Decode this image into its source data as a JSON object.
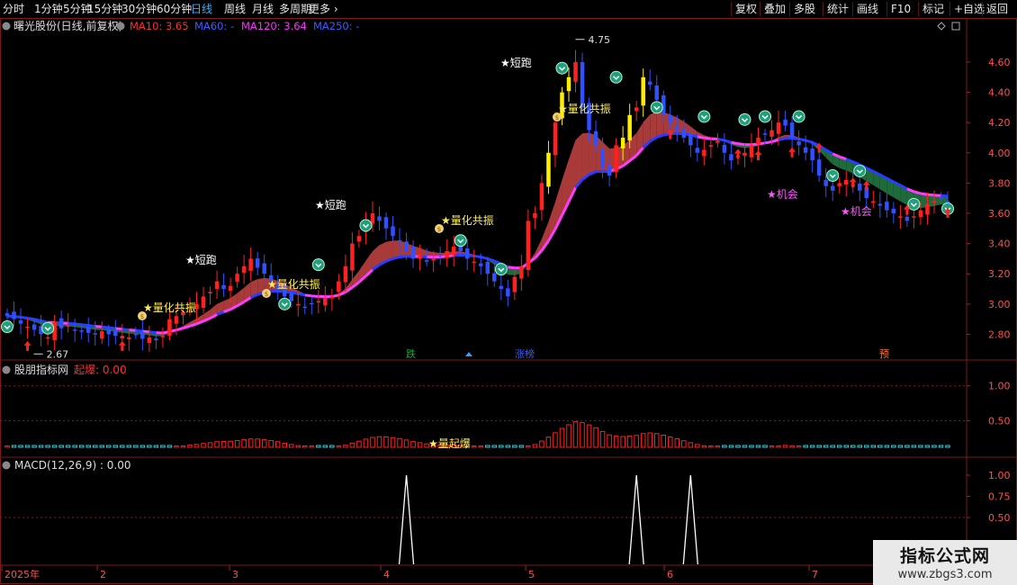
{
  "toolbar": {
    "periods": [
      "分时",
      "1分钟",
      "5分钟",
      "15分钟",
      "30分钟",
      "60分钟",
      "日线",
      "周线",
      "月线",
      "多周期",
      "更多"
    ],
    "active": "日线",
    "more_icon": "chevron-right-icon",
    "right": [
      "复权",
      "叠加",
      "多股",
      "统计",
      "画线",
      "F10",
      "标记",
      "+自选",
      "返回"
    ]
  },
  "main_panel": {
    "title": "曙光股份(日线,前复权)",
    "ma_labels": [
      {
        "text": "MA10: 3.65",
        "color": "#ff3030"
      },
      {
        "text": "MA60: -",
        "color": "#3a5cff"
      },
      {
        "text": "MA120: 3.64",
        "color": "#ff30ff"
      },
      {
        "text": "MA250: -",
        "color": "#3a5cff"
      }
    ],
    "y_ticks": [
      "4.60",
      "4.40",
      "4.20",
      "4.00",
      "3.80",
      "3.60",
      "3.40",
      "3.20",
      "3.00",
      "2.80"
    ],
    "y_range": [
      2.63,
      4.82
    ],
    "high_label": "4.75",
    "low_label": "2.67",
    "signals": {
      "short_run": "短跑",
      "resonance": "量化共振",
      "opportunity": "机会"
    },
    "bottom_tags": [
      "跌",
      "涨榜",
      "预"
    ]
  },
  "panel2": {
    "title": "股朋指标网",
    "indicator": "起爆: 0.00",
    "y_ticks": [
      "1.00",
      "0.50"
    ],
    "signal_label": "量起爆"
  },
  "panel3": {
    "title": "MACD(12,26,9) : 0.00",
    "y_ticks": [
      "1.00",
      "0.75",
      "0.50"
    ]
  },
  "x_axis": {
    "labels": [
      "2025年",
      "2",
      "3",
      "4",
      "5",
      "6",
      "7"
    ]
  },
  "watermark": {
    "title": "指标公式网",
    "url": "www.zbgs3.com"
  },
  "chart_data": {
    "type": "candlestick",
    "price_range": [
      2.63,
      4.82
    ],
    "series_close": [
      2.92,
      2.9,
      2.87,
      2.85,
      2.83,
      2.8,
      2.78,
      2.88,
      2.84,
      2.86,
      2.83,
      2.82,
      2.81,
      2.8,
      2.82,
      2.8,
      2.79,
      2.79,
      2.78,
      2.8,
      2.77,
      2.78,
      2.76,
      2.79,
      2.9,
      2.92,
      2.95,
      2.98,
      3.0,
      3.05,
      3.08,
      3.15,
      3.1,
      3.12,
      3.2,
      3.25,
      3.3,
      3.24,
      3.2,
      3.15,
      3.1,
      3.05,
      3.02,
      3.0,
      2.98,
      3.0,
      3.02,
      3.04,
      3.05,
      3.15,
      3.25,
      3.4,
      3.45,
      3.55,
      3.6,
      3.55,
      3.5,
      3.45,
      3.42,
      3.35,
      3.3,
      3.32,
      3.28,
      3.3,
      3.32,
      3.35,
      3.38,
      3.35,
      3.3,
      3.28,
      3.25,
      3.2,
      3.15,
      3.1,
      3.05,
      3.18,
      3.25,
      3.55,
      3.6,
      3.8,
      4.0,
      4.2,
      4.4,
      4.5,
      4.6,
      4.3,
      4.15,
      4.05,
      3.9,
      3.85,
      4.05,
      4.1,
      4.25,
      4.3,
      4.5,
      4.45,
      4.35,
      4.25,
      4.2,
      4.15,
      4.1,
      4.05,
      4.0,
      4.02,
      4.05,
      4.08,
      4.0,
      3.95,
      3.98,
      4.0,
      4.05,
      4.1,
      4.12,
      4.15,
      4.2,
      4.18,
      4.1,
      4.05,
      4.0,
      3.95,
      3.85,
      3.78,
      3.75,
      3.8,
      3.82,
      3.78,
      3.75,
      3.7,
      3.68,
      3.65,
      3.62,
      3.6,
      3.58,
      3.55,
      3.58,
      3.62,
      3.66,
      3.68,
      3.7,
      3.67
    ],
    "macd_spikes": [
      {
        "x_date_index": 59,
        "value": 1.0
      },
      {
        "x_date_index": 93,
        "value": 1.0
      },
      {
        "x_date_index": 101,
        "value": 1.0
      }
    ],
    "macd_y_range": [
      0,
      1.0
    ]
  }
}
